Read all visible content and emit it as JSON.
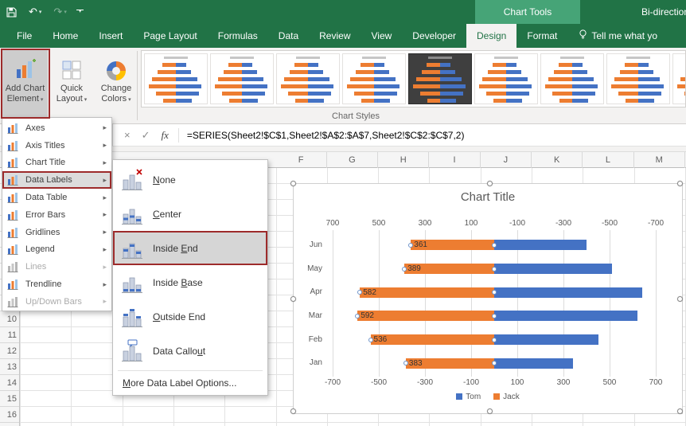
{
  "colors": {
    "excel_green": "#217346",
    "series_blue": "#4472c4",
    "series_orange": "#ed7d31",
    "annotation_red": "#9d2b2b"
  },
  "titlebar": {
    "chart_tools": "Chart Tools",
    "workbook_title": "Bi-directional"
  },
  "tabs": {
    "items": [
      "File",
      "Home",
      "Insert",
      "Page Layout",
      "Formulas",
      "Data",
      "Review",
      "View",
      "Developer",
      "Design",
      "Format"
    ],
    "active": "Design",
    "tell_me": "Tell me what yo"
  },
  "ribbon": {
    "add_chart_element": {
      "line1": "Add Chart",
      "line2": "Element"
    },
    "quick_layout": {
      "line1": "Quick",
      "line2": "Layout"
    },
    "change_colors": {
      "line1": "Change",
      "line2": "Colors"
    },
    "group_label": "Chart Styles",
    "gallery": {
      "count": 9,
      "dark_index": 4
    }
  },
  "formula_bar": {
    "cancel": "×",
    "enter": "✓",
    "fx_label": "fx",
    "formula": "=SERIES(Sheet2!$C$1,Sheet2!$A$2:$A$7,Sheet2!$C$2:$C$7,2)"
  },
  "sheet": {
    "column_headers": [
      "F",
      "G",
      "H",
      "I",
      "J",
      "K",
      "L",
      "M"
    ],
    "row_numbers": [
      "10",
      "11",
      "12",
      "13",
      "14",
      "15",
      "16"
    ]
  },
  "menu": {
    "items": [
      {
        "label": "Axes",
        "has_submenu": true
      },
      {
        "label": "Axis Titles",
        "has_submenu": true
      },
      {
        "label": "Chart Title",
        "has_submenu": true
      },
      {
        "label": "Data Labels",
        "has_submenu": true,
        "highlighted": true
      },
      {
        "label": "Data Table",
        "has_submenu": true
      },
      {
        "label": "Error Bars",
        "has_submenu": true
      },
      {
        "label": "Gridlines",
        "has_submenu": true
      },
      {
        "label": "Legend",
        "has_submenu": true
      },
      {
        "label": "Lines",
        "has_submenu": true,
        "disabled": true
      },
      {
        "label": "Trendline",
        "has_submenu": true
      },
      {
        "label": "Up/Down Bars",
        "has_submenu": true,
        "disabled": true
      }
    ]
  },
  "submenu": {
    "items": [
      {
        "label": "None",
        "key": "N",
        "icon": "none"
      },
      {
        "label": "Center",
        "key": "C",
        "icon": "center"
      },
      {
        "label": "Inside End",
        "key": "E",
        "icon": "inside-end",
        "selected": true
      },
      {
        "label": "Inside Base",
        "key": "B",
        "icon": "inside-base"
      },
      {
        "label": "Outside End",
        "key": "O",
        "icon": "outside-end"
      },
      {
        "label": "Data Callout",
        "key": "u",
        "icon": "data-callout"
      }
    ],
    "footer": {
      "label": "More Data Label Options...",
      "key": "M"
    }
  },
  "chart_data": {
    "type": "bar",
    "orientation": "horizontal-bidirectional",
    "title": "Chart Title",
    "categories": [
      "Jun",
      "May",
      "Apr",
      "Mar",
      "Feb",
      "Jan"
    ],
    "series": [
      {
        "name": "Tom",
        "color": "#4472c4",
        "direction": "right",
        "estimated": true,
        "values": [
          400,
          510,
          640,
          620,
          450,
          340
        ]
      },
      {
        "name": "Jack",
        "color": "#ed7d31",
        "direction": "left",
        "values": [
          361,
          389,
          582,
          592,
          536,
          383
        ],
        "data_labels": [
          "361",
          "389",
          "582",
          "592",
          "536",
          "383"
        ],
        "data_label_position": "inside-end"
      }
    ],
    "axis_top_ticks": [
      "700",
      "500",
      "300",
      "100",
      "-100",
      "-300",
      "-500",
      "-700"
    ],
    "axis_bottom_ticks": [
      "-700",
      "-500",
      "-300",
      "-100",
      "100",
      "300",
      "500",
      "700"
    ],
    "xlim": [
      -700,
      700
    ],
    "grid": true,
    "legend": [
      "Tom",
      "Jack"
    ],
    "legend_position": "bottom"
  }
}
